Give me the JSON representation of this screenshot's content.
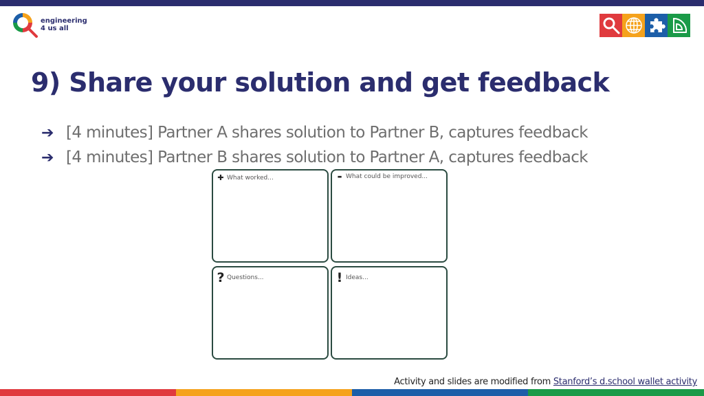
{
  "header": {
    "logo_line1": "engineering",
    "logo_line2": "4 us all",
    "icon_strip": [
      {
        "name": "magnifier-icon",
        "color": "#e03a3e"
      },
      {
        "name": "globe-icon",
        "color": "#f5a21c"
      },
      {
        "name": "puzzle-icon",
        "color": "#1c5ea8"
      },
      {
        "name": "protractor-icon",
        "color": "#1a9a48"
      }
    ]
  },
  "slide": {
    "title": "9) Share your solution and get feedback",
    "bullets": [
      {
        "arrow": "➔",
        "text": "[4 minutes] Partner A shares solution to Partner B, captures feedback"
      },
      {
        "arrow": "➔",
        "text": "[4 minutes] Partner B shares solution to Partner A, captures feedback"
      }
    ]
  },
  "feedback_grid": [
    {
      "icon": "✚",
      "icon_name": "plus-icon",
      "label": "What worked..."
    },
    {
      "icon": "▬",
      "icon_name": "minus-icon",
      "label": "What could be improved..."
    },
    {
      "icon": "?",
      "icon_name": "question-icon",
      "label": "Questions..."
    },
    {
      "icon": "!",
      "icon_name": "exclamation-icon",
      "label": "Ideas..."
    }
  ],
  "footer": {
    "note_prefix": "Activity and slides are modified from ",
    "link_text": "Stanford’s d.school wallet activity"
  },
  "colors": {
    "brand_navy": "#2b2d6e",
    "bar_red": "#e03a3e",
    "bar_orange": "#f5a21c",
    "bar_blue": "#1c5ea8",
    "bar_green": "#1a9a48"
  }
}
